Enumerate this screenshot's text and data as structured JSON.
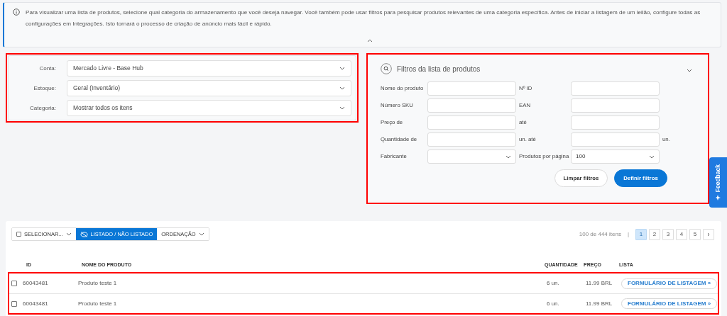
{
  "info_banner": {
    "text": "Para visualizar uma lista de produtos, selecione qual categoria do armazenamento que você deseja navegar. Você também pode usar filtros para pesquisar produtos relevantes de uma categoria específica. Antes de iniciar a listagem de um leilão, configure todas as configurações em Integrações. Isto tornará o processo de criação de anúncio mais fácil e rápido."
  },
  "source_filters": [
    {
      "label": "Conta:",
      "value": "Mercado Livre - Base Hub"
    },
    {
      "label": "Estoque:",
      "value": "Geral (Inventário)"
    },
    {
      "label": "Categoria:",
      "value": "Mostrar todos os itens"
    }
  ],
  "product_filters": {
    "title": "Filtros da lista de produtos",
    "fields": [
      {
        "label": "Nome do produto",
        "kind": "text"
      },
      {
        "label": "Nº ID",
        "kind": "text"
      },
      {
        "label": "Número SKU",
        "kind": "text"
      },
      {
        "label": "EAN",
        "kind": "text"
      },
      {
        "label": "Preço de",
        "kind": "text"
      },
      {
        "label": "até",
        "kind": "text"
      },
      {
        "label": "Quantidade de",
        "kind": "text"
      },
      {
        "label": "un. até",
        "kind": "text",
        "suffix": "un."
      },
      {
        "label": "Fabricante",
        "kind": "select"
      },
      {
        "label": "Produtos por página",
        "kind": "select",
        "value": "100"
      }
    ],
    "buttons": [
      {
        "label": "Limpar filtros",
        "kind": "secondary"
      },
      {
        "label": "Definir filtros",
        "kind": "primary"
      }
    ]
  },
  "feedback_tab": {
    "label": "Feedback"
  },
  "toolbar": [
    {
      "label": "SELECIONAR...",
      "kind": "checkbox-menu",
      "selected": false
    },
    {
      "label": "LISTADO / NÃO LISTADO",
      "kind": "toggle",
      "selected": true
    },
    {
      "label": "ORDENAÇÃO",
      "kind": "menu",
      "selected": false
    }
  ],
  "pagination": {
    "summary": "100 de 444 itens",
    "separator": "|",
    "pages": [
      {
        "label": "1",
        "selected": true
      },
      {
        "label": "2",
        "selected": false
      },
      {
        "label": "3",
        "selected": false
      },
      {
        "label": "4",
        "selected": false
      },
      {
        "label": "5",
        "selected": false
      }
    ]
  },
  "table": {
    "columns": [
      "ID",
      "NOME DO PRODUTO",
      "QUANTIDADE",
      "PREÇO",
      "LISTA"
    ],
    "rows": [
      {
        "checked": false,
        "id": "60043481",
        "name": "Produto teste 1",
        "quantity": "6 un.",
        "price": "11.99 BRL",
        "action": "FORMULÁRIO DE LISTAGEM »"
      },
      {
        "checked": false,
        "id": "60043481",
        "name": "Produto teste 1",
        "quantity": "6 un.",
        "price": "11.99 BRL",
        "action": "FORMULÁRIO DE LISTAGEM »"
      }
    ]
  }
}
